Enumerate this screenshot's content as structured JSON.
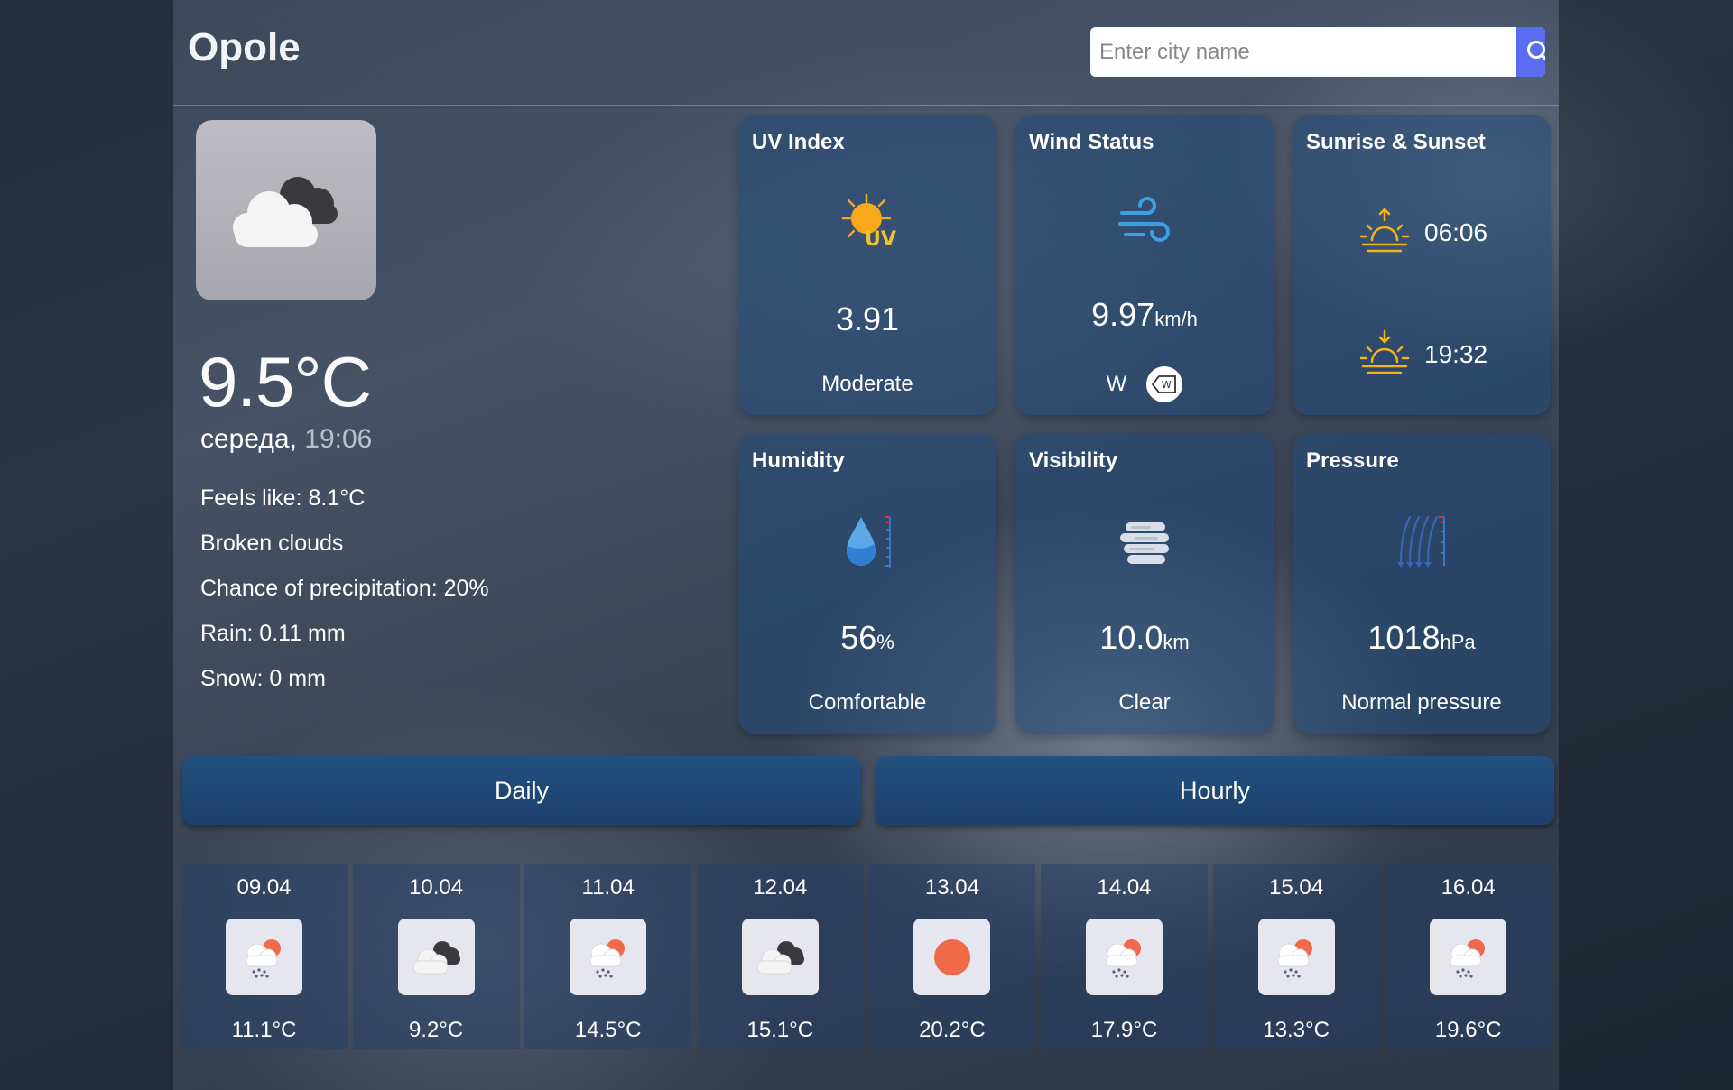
{
  "header": {
    "city": "Opole",
    "search_placeholder": "Enter city name"
  },
  "current": {
    "temperature": "9.5°C",
    "day": "середа,",
    "time": "19:06",
    "feels_like": "Feels like: 8.1°C",
    "description": "Broken clouds",
    "precipitation": "Chance of precipitation: 20%",
    "rain": "Rain: 0.11 mm",
    "snow": "Snow: 0 mm",
    "icon": "broken-clouds-icon"
  },
  "cards": {
    "uv": {
      "title": "UV Index",
      "value": "3.91",
      "desc": "Moderate",
      "icon": "uv-sun-icon"
    },
    "wind": {
      "title": "Wind Status",
      "value": "9.97",
      "unit": "km/h",
      "direction": "W",
      "badge": "W",
      "icon": "wind-icon"
    },
    "sun": {
      "title": "Sunrise & Sunset",
      "sunrise": "06:06",
      "sunset": "19:32"
    },
    "humidity": {
      "title": "Humidity",
      "value": "56",
      "unit": "%",
      "desc": "Comfortable",
      "icon": "humidity-icon"
    },
    "visibility": {
      "title": "Visibility",
      "value": "10.0",
      "unit": "km",
      "desc": "Clear",
      "icon": "fog-icon"
    },
    "pressure": {
      "title": "Pressure",
      "value": "1018",
      "unit": "hPa",
      "desc": "Normal pressure",
      "icon": "pressure-icon"
    }
  },
  "tabs": {
    "daily": "Daily",
    "hourly": "Hourly"
  },
  "forecast": [
    {
      "date": "09.04",
      "temp": "11.1°C",
      "icon": "rain-icon"
    },
    {
      "date": "10.04",
      "temp": "9.2°C",
      "icon": "broken-clouds-icon"
    },
    {
      "date": "11.04",
      "temp": "14.5°C",
      "icon": "rain-icon"
    },
    {
      "date": "12.04",
      "temp": "15.1°C",
      "icon": "broken-clouds-icon"
    },
    {
      "date": "13.04",
      "temp": "20.2°C",
      "icon": "clear-sky-icon"
    },
    {
      "date": "14.04",
      "temp": "17.9°C",
      "icon": "rain-icon"
    },
    {
      "date": "15.04",
      "temp": "13.3°C",
      "icon": "rain-icon"
    },
    {
      "date": "16.04",
      "temp": "19.6°C",
      "icon": "rain-icon"
    }
  ]
}
